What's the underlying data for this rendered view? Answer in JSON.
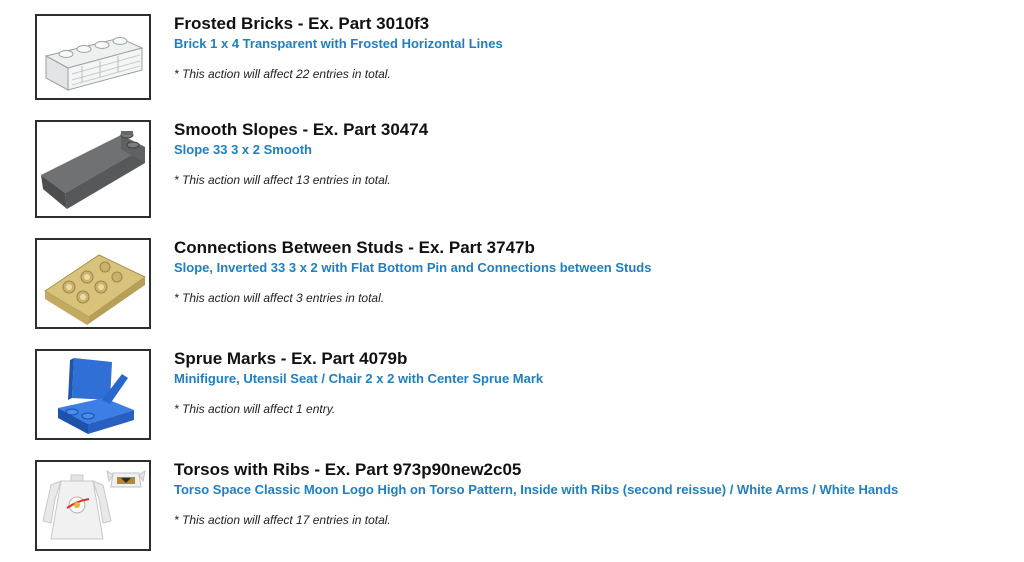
{
  "items": [
    {
      "icon": "transparent-brick-icon",
      "title": "Frosted Bricks - Ex. Part 3010f3",
      "subtitle": "Brick 1 x 4 Transparent with Frosted Horizontal Lines",
      "note": "* This action will affect 22 entries in total."
    },
    {
      "icon": "dark-gray-slope-icon",
      "title": "Smooth Slopes - Ex. Part 30474",
      "subtitle": "Slope 33 3 x 2 Smooth",
      "note": "* This action will affect 13 entries in total."
    },
    {
      "icon": "tan-inverted-slope-icon",
      "title": "Connections Between Studs - Ex. Part 3747b",
      "subtitle": "Slope, Inverted 33 3 x 2 with Flat Bottom Pin and Connections between Studs",
      "note": "* This action will affect 3 entries in total."
    },
    {
      "icon": "blue-chair-icon",
      "title": "Sprue Marks - Ex. Part 4079b",
      "subtitle": "Minifigure, Utensil Seat / Chair 2 x 2 with Center Sprue Mark",
      "note": "* This action will affect 1 entry."
    },
    {
      "icon": "white-torso-icon",
      "title": "Torsos with Ribs - Ex. Part 973p90new2c05",
      "subtitle": "Torso Space Classic Moon Logo High on Torso Pattern, Inside with Ribs (second reissue) / White Arms / White Hands",
      "note": "* This action will affect 17 entries in total."
    }
  ],
  "colors": {
    "title": "#111111",
    "link": "#1f7fc0",
    "border": "#2e2e2e"
  }
}
